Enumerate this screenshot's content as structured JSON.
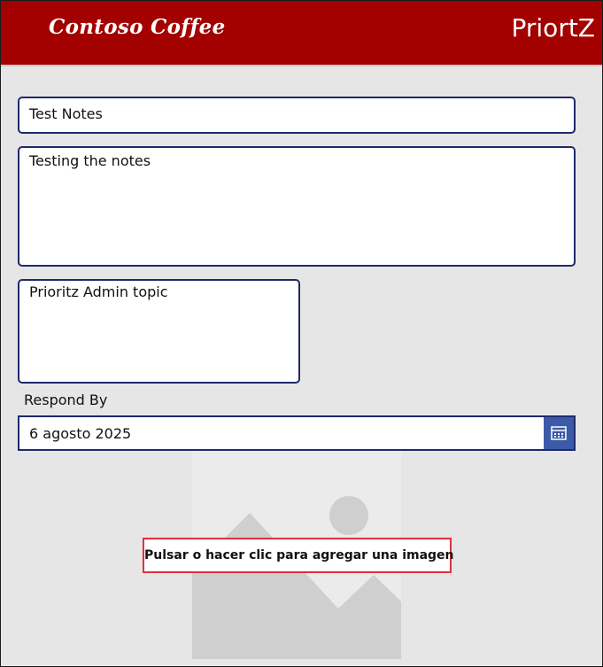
{
  "header": {
    "logo_text": "Contoso Coffee",
    "app_title": "PriortZ",
    "background_color": "#a30000"
  },
  "form": {
    "title_value": "Test Notes",
    "notes_value": "Testing the notes",
    "topic_value": "Prioritz Admin topic",
    "respond_by_label": "Respond By",
    "respond_by_value": "6 agosto 2025"
  },
  "image_control": {
    "prompt_text": "Pulsar o hacer clic para agregar una imagen",
    "icon": "image-placeholder-icon"
  },
  "colors": {
    "field_border": "#1f2a6b",
    "calendar_button": "#3b5ba8",
    "highlight_border": "#e0303d",
    "canvas_background": "#e6e6e6"
  }
}
